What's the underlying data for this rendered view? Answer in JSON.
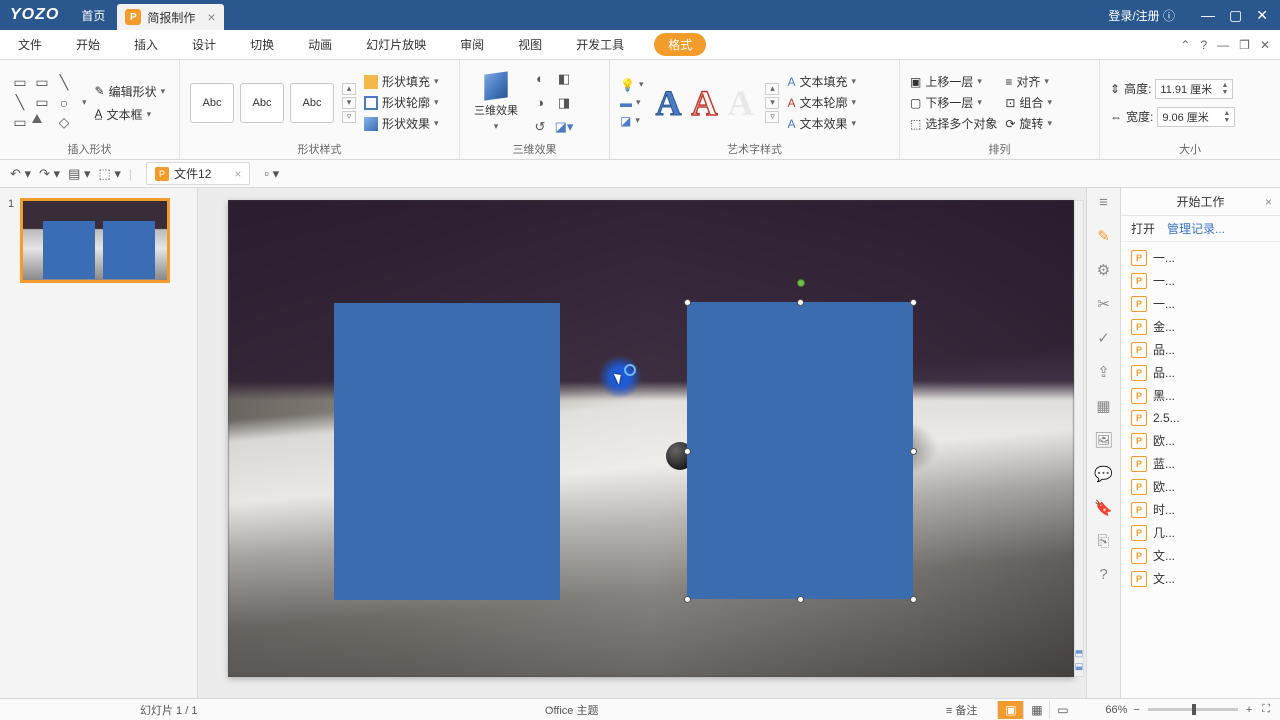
{
  "app": {
    "logo": "YOZO",
    "home": "首页",
    "file_tab": "简报制作",
    "login": "登录/注册"
  },
  "menu": {
    "items": [
      "文件",
      "开始",
      "插入",
      "设计",
      "切换",
      "动画",
      "幻灯片放映",
      "审阅",
      "视图",
      "开发工具",
      "格式"
    ],
    "active": 10
  },
  "ribbon": {
    "insert_shape": {
      "label": "插入形状",
      "edit_shape": "编辑形状",
      "text_box": "文本框"
    },
    "shape_style": {
      "label": "形状样式",
      "box": "Abc",
      "fill": "形状填充",
      "outline": "形状轮廓",
      "effect": "形状效果"
    },
    "three_d": {
      "label": "三维效果",
      "btn": "三维效果"
    },
    "art": {
      "label": "艺术字样式",
      "fill": "文本填充",
      "outline": "文本轮廓",
      "effect": "文本效果"
    },
    "arrange": {
      "label": "排列",
      "up": "上移一层",
      "down": "下移一层",
      "select": "选择多个对象",
      "align": "对齐",
      "group": "组合",
      "rotate": "旋转"
    },
    "size": {
      "label": "大小",
      "height": "高度:",
      "width": "宽度:",
      "h_val": "11.91 厘米",
      "w_val": "9.06 厘米"
    }
  },
  "docbar": {
    "file": "文件12"
  },
  "thumb": {
    "num": "1"
  },
  "task": {
    "title": "开始工作",
    "open": "打开",
    "manage": "管理记录...",
    "items": [
      "一...",
      "一...",
      "一...",
      "金...",
      "品...",
      "品...",
      "黑...",
      "2.5...",
      "欧...",
      "蓝...",
      "欧...",
      "时...",
      "几...",
      "文...",
      "文..."
    ]
  },
  "status": {
    "slide": "幻灯片 1 / 1",
    "theme": "Office 主题",
    "notes": "备注",
    "zoom": "66%"
  }
}
